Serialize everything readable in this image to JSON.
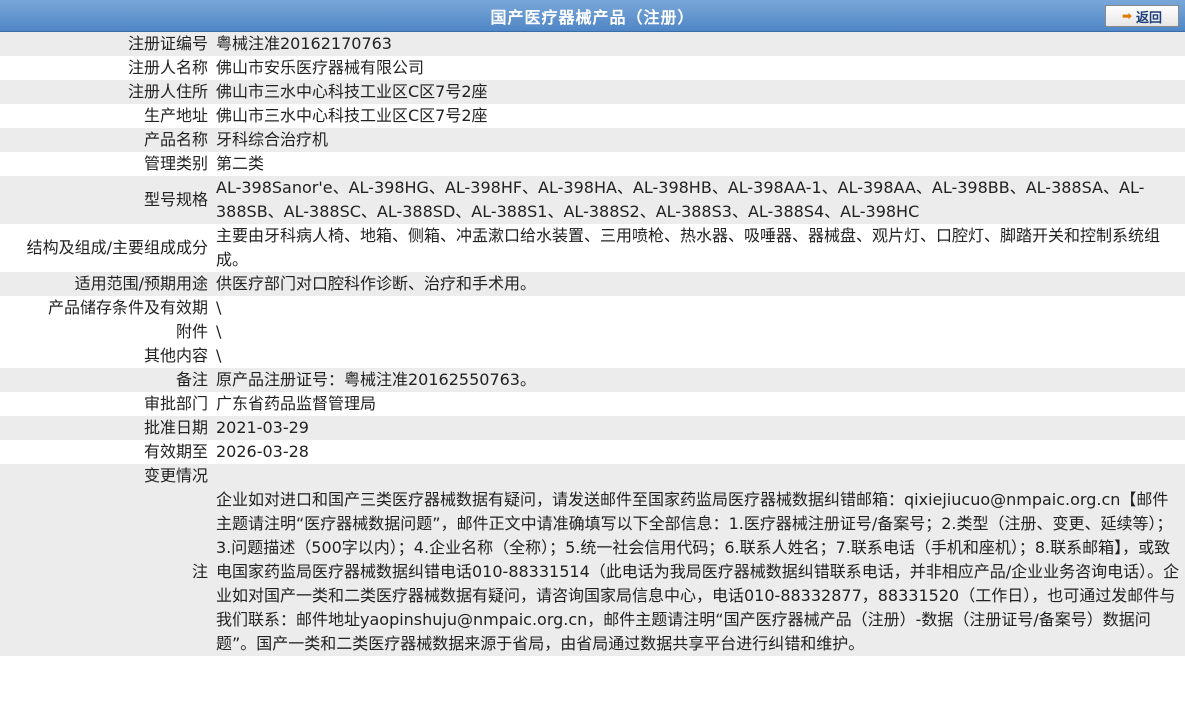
{
  "header": {
    "title": "国产医疗器械产品（注册）",
    "back_label": "返回"
  },
  "rows": [
    {
      "label": "注册证编号",
      "value": "粤械注准20162170763"
    },
    {
      "label": "注册人名称",
      "value": "佛山市安乐医疗器械有限公司"
    },
    {
      "label": "注册人住所",
      "value": "佛山市三水中心科技工业区C区7号2座"
    },
    {
      "label": "生产地址",
      "value": "佛山市三水中心科技工业区C区7号2座"
    },
    {
      "label": "产品名称",
      "value": "牙科综合治疗机"
    },
    {
      "label": "管理类别",
      "value": "第二类"
    },
    {
      "label": "型号规格",
      "value": "AL-398Sanor'e、AL-398HG、AL-398HF、AL-398HA、AL-398HB、AL-398AA-1、AL-398AA、AL-398BB、AL-388SA、AL-388SB、AL-388SC、AL-388SD、AL-388S1、AL-388S2、AL-388S3、AL-388S4、AL-398HC"
    },
    {
      "label": "结构及组成/主要组成成分",
      "value": "主要由牙科病人椅、地箱、侧箱、冲盂漱口给水装置、三用喷枪、热水器、吸唾器、器械盘、观片灯、口腔灯、脚踏开关和控制系统组成。"
    },
    {
      "label": "适用范围/预期用途",
      "value": "供医疗部门对口腔科作诊断、治疗和手术用。"
    },
    {
      "label": "产品储存条件及有效期",
      "value": "\\"
    },
    {
      "label": "附件",
      "value": "\\"
    },
    {
      "label": "其他内容",
      "value": "\\"
    },
    {
      "label": "备注",
      "value": "原产品注册证号：粤械注准20162550763。"
    },
    {
      "label": "审批部门",
      "value": "广东省药品监督管理局"
    },
    {
      "label": "批准日期",
      "value": "2021-03-29"
    },
    {
      "label": "有效期至",
      "value": "2026-03-28"
    },
    {
      "label": "变更情况",
      "value": ""
    }
  ],
  "note": {
    "label": "注",
    "text": "企业如对进口和国产三类医疗器械数据有疑问，请发送邮件至国家药监局医疗器械数据纠错邮箱：qixiejiucuo@nmpaic.org.cn【邮件主题请注明“医疗器械数据问题”，邮件正文中请准确填写以下全部信息：1.医疗器械注册证号/备案号；2.类型（注册、变更、延续等）；3.问题描述（500字以内）；4.企业名称（全称）；5.统一社会信用代码；6.联系人姓名；7.联系电话（手机和座机）；8.联系邮箱】，或致电国家药监局医疗器械数据纠错电话010-88331514（此电话为我局医疗器械数据纠错联系电话，并非相应产品/企业业务咨询电话）。企业如对国产一类和二类医疗器械数据有疑问，请咨询国家局信息中心，电话010-88332877，88331520（工作日），也可通过发邮件与我们联系：邮件地址yaopinshuju@nmpaic.org.cn，邮件主题请注明“国产医疗器械产品（注册）-数据（注册证号/备案号）数据问题”。国产一类和二类医疗器械数据来源于省局，由省局通过数据共享平台进行纠错和维护。"
  },
  "colors": {
    "header_bg": "#4f86c6",
    "row_gray": "#ececec",
    "row_white": "#ffffff"
  }
}
